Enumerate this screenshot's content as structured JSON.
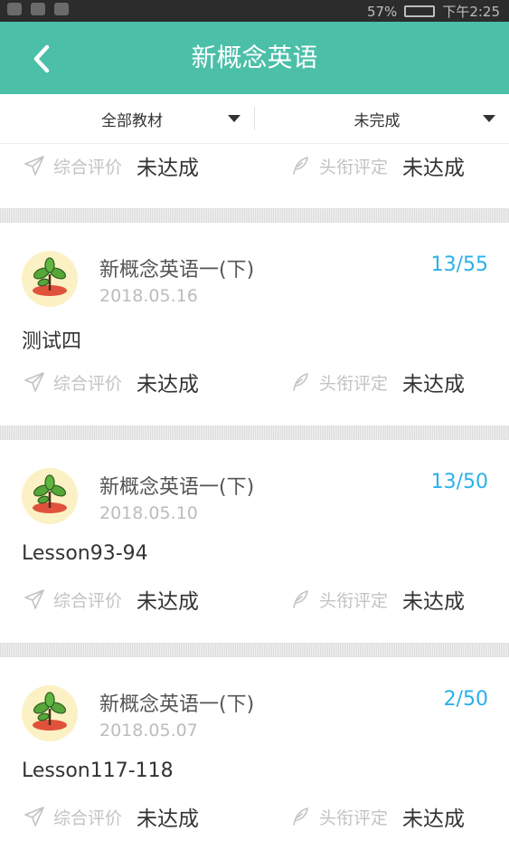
{
  "status_bar": {
    "battery": "57%",
    "time": "下午2:25"
  },
  "appbar": {
    "title": "新概念英语"
  },
  "filters": {
    "material": "全部教材",
    "status": "未完成"
  },
  "eval_labels": {
    "overall": "综合评价",
    "title": "头衔评定"
  },
  "top_card": {
    "overall": "未达成",
    "title_value": "未达成"
  },
  "cards": [
    {
      "book": "新概念英语一(下)",
      "date": "2018.05.16",
      "progress": "13/55",
      "name": "测试四",
      "overall": "未达成",
      "title_value": "未达成"
    },
    {
      "book": "新概念英语一(下)",
      "date": "2018.05.10",
      "progress": "13/50",
      "name": "Lesson93-94",
      "overall": "未达成",
      "title_value": "未达成"
    },
    {
      "book": "新概念英语一(下)",
      "date": "2018.05.07",
      "progress": "2/50",
      "name": "Lesson117-118",
      "overall": "未达成",
      "title_value": "未达成"
    }
  ],
  "colors": {
    "accent": "#4bbfa7",
    "progress": "#2ab0ea"
  }
}
